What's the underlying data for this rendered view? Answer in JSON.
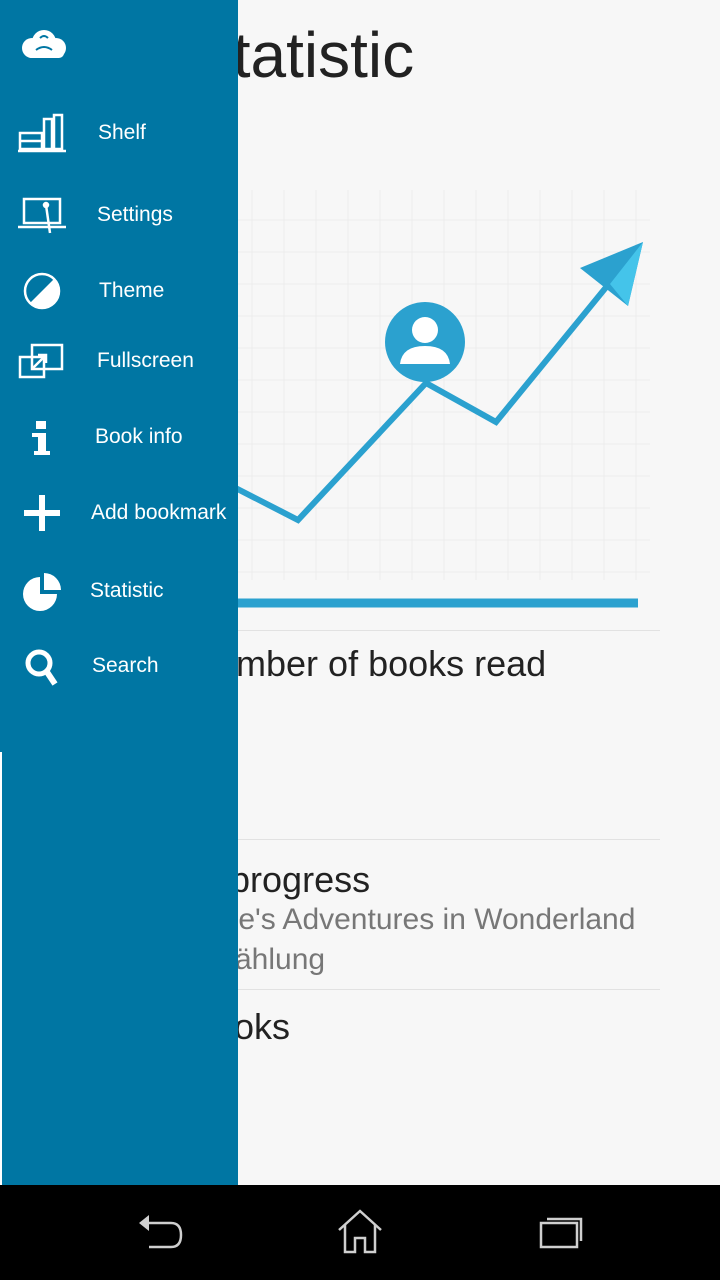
{
  "page": {
    "title": "Statistic",
    "sections": [
      {
        "title": "Number of books read",
        "subtitles": []
      },
      {
        "title": "In progress",
        "subtitles": [
          "Alice's Adventures in Wonderland",
          "Erzählung"
        ]
      },
      {
        "title": "Books",
        "subtitles": []
      }
    ]
  },
  "drawer": {
    "logo_icon": "cloud-logo-icon",
    "items": [
      {
        "label": "Shelf",
        "icon": "bookshelf-icon"
      },
      {
        "label": "Settings",
        "icon": "laptop-settings-icon"
      },
      {
        "label": "Theme",
        "icon": "theme-circle-icon"
      },
      {
        "label": "Fullscreen",
        "icon": "fullscreen-icon"
      },
      {
        "label": "Book info",
        "icon": "info-icon"
      },
      {
        "label": "Add bookmark",
        "icon": "plus-icon"
      },
      {
        "label": "Statistic",
        "icon": "pie-chart-icon"
      },
      {
        "label": "Search",
        "icon": "search-icon"
      }
    ]
  },
  "navbar": {
    "back": "back-icon",
    "home": "home-icon",
    "recents": "recents-icon"
  },
  "colors": {
    "drawer_bg": "#0076a3",
    "accent": "#2ba1cf",
    "page_bg": "#f7f7f7"
  }
}
